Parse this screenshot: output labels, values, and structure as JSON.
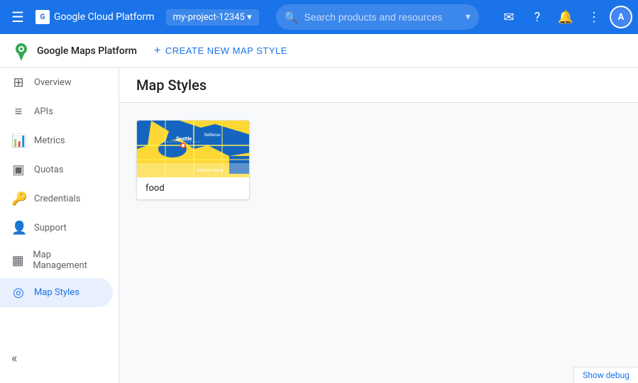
{
  "topbar": {
    "app_name": "Google Cloud Platform",
    "project_name": "my-project-12345",
    "search_placeholder": "Search products and resources",
    "menu_icon": "☰",
    "search_icon": "🔍",
    "dropdown_icon": "▾",
    "notifications_icon": "🔔",
    "help_icon": "?",
    "apps_icon": "⋮",
    "email_icon": "✉"
  },
  "subheader": {
    "app_name": "Google Maps Platform",
    "page_title": "Map Styles",
    "create_button_label": "CREATE NEW MAP STYLE",
    "create_icon": "+"
  },
  "sidebar": {
    "items": [
      {
        "id": "overview",
        "label": "Overview",
        "icon": "⊞"
      },
      {
        "id": "apis",
        "label": "APIs",
        "icon": "≡"
      },
      {
        "id": "metrics",
        "label": "Metrics",
        "icon": "📊"
      },
      {
        "id": "quotas",
        "label": "Quotas",
        "icon": "▣"
      },
      {
        "id": "credentials",
        "label": "Credentials",
        "icon": "🔑"
      },
      {
        "id": "support",
        "label": "Support",
        "icon": "👤"
      },
      {
        "id": "map-management",
        "label": "Map Management",
        "icon": "▦"
      },
      {
        "id": "map-styles",
        "label": "Map Styles",
        "icon": "◎",
        "active": true
      }
    ],
    "collapse_icon": "«"
  },
  "map_styles": {
    "cards": [
      {
        "id": "food",
        "label": "food",
        "thumbnail_alt": "Map style thumbnail showing Seattle area"
      }
    ]
  },
  "debug_bar": {
    "label": "Show debug"
  },
  "colors": {
    "primary": "#1a73e8",
    "active_nav": "#e8f0fe",
    "active_text": "#1a73e8"
  }
}
